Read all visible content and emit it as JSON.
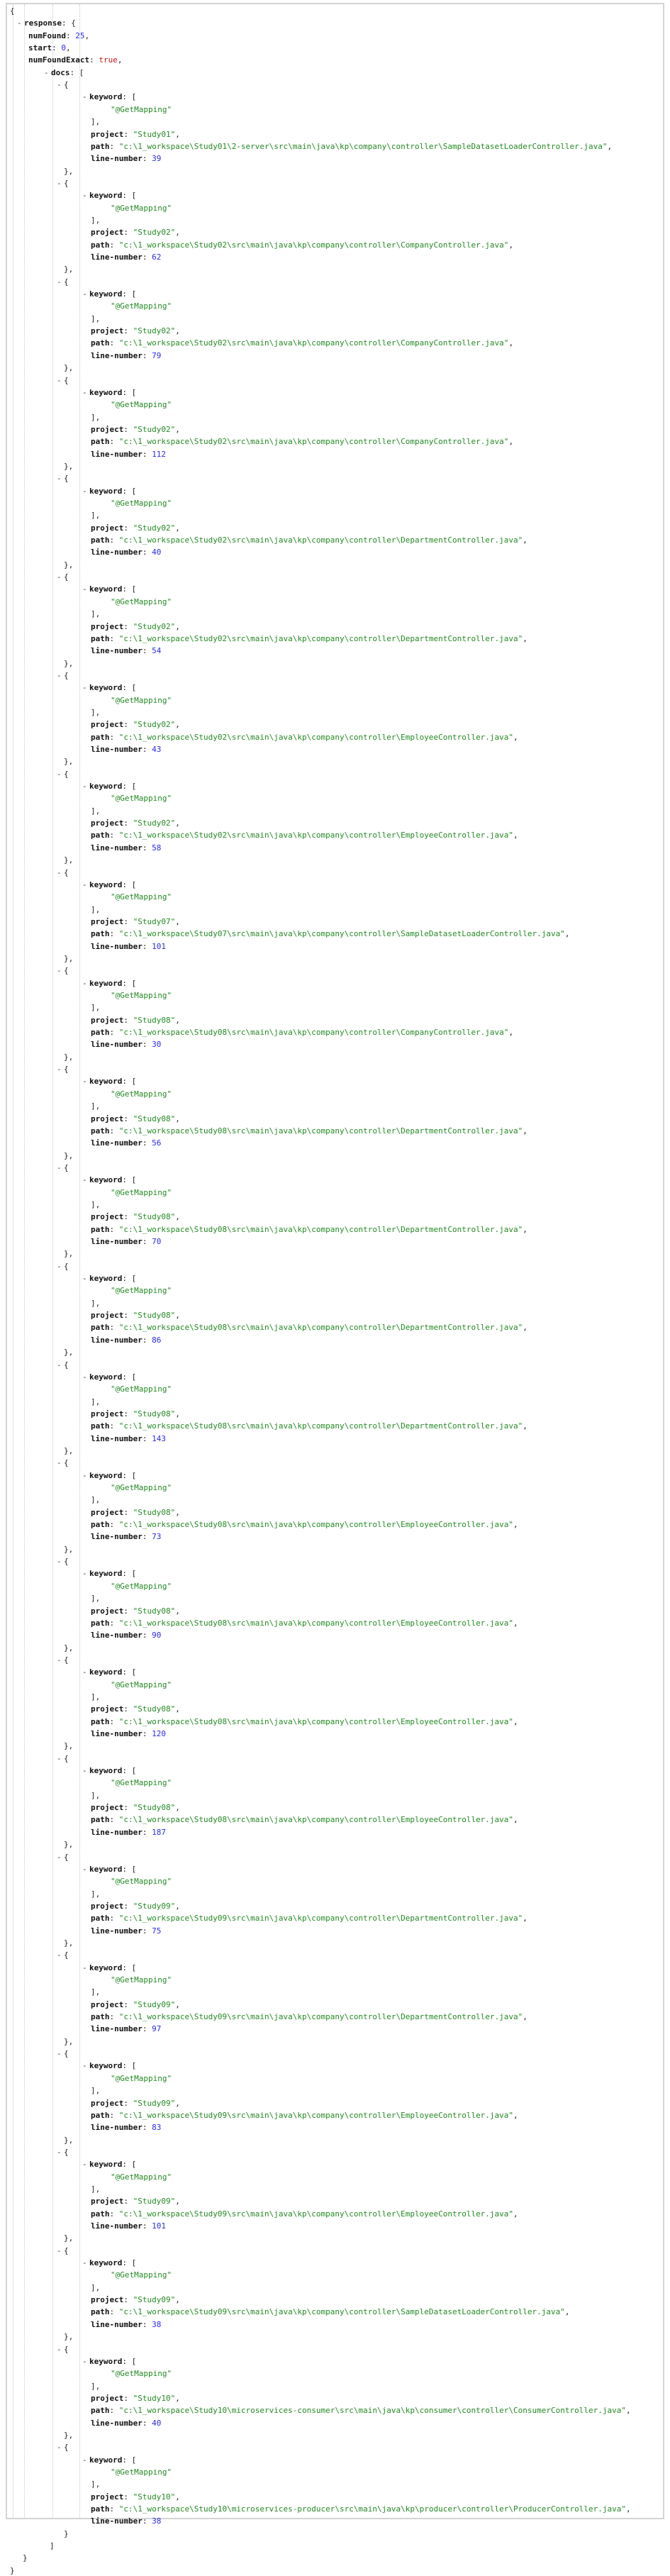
{
  "response": {
    "numFound": 25,
    "start": 0,
    "numFoundExact": true,
    "docs": [
      {
        "keyword": [
          "@GetMapping"
        ],
        "project": "Study01",
        "path": "c:\\1_workspace\\Study01\\2-server\\src\\main\\java\\kp\\company\\controller\\SampleDatasetLoaderController.java",
        "line_number": 39
      },
      {
        "keyword": [
          "@GetMapping"
        ],
        "project": "Study02",
        "path": "c:\\1_workspace\\Study02\\src\\main\\java\\kp\\company\\controller\\CompanyController.java",
        "line_number": 62
      },
      {
        "keyword": [
          "@GetMapping"
        ],
        "project": "Study02",
        "path": "c:\\1_workspace\\Study02\\src\\main\\java\\kp\\company\\controller\\CompanyController.java",
        "line_number": 79
      },
      {
        "keyword": [
          "@GetMapping"
        ],
        "project": "Study02",
        "path": "c:\\1_workspace\\Study02\\src\\main\\java\\kp\\company\\controller\\CompanyController.java",
        "line_number": 112
      },
      {
        "keyword": [
          "@GetMapping"
        ],
        "project": "Study02",
        "path": "c:\\1_workspace\\Study02\\src\\main\\java\\kp\\company\\controller\\DepartmentController.java",
        "line_number": 40
      },
      {
        "keyword": [
          "@GetMapping"
        ],
        "project": "Study02",
        "path": "c:\\1_workspace\\Study02\\src\\main\\java\\kp\\company\\controller\\DepartmentController.java",
        "line_number": 54
      },
      {
        "keyword": [
          "@GetMapping"
        ],
        "project": "Study02",
        "path": "c:\\1_workspace\\Study02\\src\\main\\java\\kp\\company\\controller\\EmployeeController.java",
        "line_number": 43
      },
      {
        "keyword": [
          "@GetMapping"
        ],
        "project": "Study02",
        "path": "c:\\1_workspace\\Study02\\src\\main\\java\\kp\\company\\controller\\EmployeeController.java",
        "line_number": 58
      },
      {
        "keyword": [
          "@GetMapping"
        ],
        "project": "Study07",
        "path": "c:\\1_workspace\\Study07\\src\\main\\java\\kp\\company\\controller\\SampleDatasetLoaderController.java",
        "line_number": 101
      },
      {
        "keyword": [
          "@GetMapping"
        ],
        "project": "Study08",
        "path": "c:\\1_workspace\\Study08\\src\\main\\java\\kp\\company\\controller\\CompanyController.java",
        "line_number": 30
      },
      {
        "keyword": [
          "@GetMapping"
        ],
        "project": "Study08",
        "path": "c:\\1_workspace\\Study08\\src\\main\\java\\kp\\company\\controller\\DepartmentController.java",
        "line_number": 56
      },
      {
        "keyword": [
          "@GetMapping"
        ],
        "project": "Study08",
        "path": "c:\\1_workspace\\Study08\\src\\main\\java\\kp\\company\\controller\\DepartmentController.java",
        "line_number": 70
      },
      {
        "keyword": [
          "@GetMapping"
        ],
        "project": "Study08",
        "path": "c:\\1_workspace\\Study08\\src\\main\\java\\kp\\company\\controller\\DepartmentController.java",
        "line_number": 86
      },
      {
        "keyword": [
          "@GetMapping"
        ],
        "project": "Study08",
        "path": "c:\\1_workspace\\Study08\\src\\main\\java\\kp\\company\\controller\\DepartmentController.java",
        "line_number": 143
      },
      {
        "keyword": [
          "@GetMapping"
        ],
        "project": "Study08",
        "path": "c:\\1_workspace\\Study08\\src\\main\\java\\kp\\company\\controller\\EmployeeController.java",
        "line_number": 73
      },
      {
        "keyword": [
          "@GetMapping"
        ],
        "project": "Study08",
        "path": "c:\\1_workspace\\Study08\\src\\main\\java\\kp\\company\\controller\\EmployeeController.java",
        "line_number": 90
      },
      {
        "keyword": [
          "@GetMapping"
        ],
        "project": "Study08",
        "path": "c:\\1_workspace\\Study08\\src\\main\\java\\kp\\company\\controller\\EmployeeController.java",
        "line_number": 120
      },
      {
        "keyword": [
          "@GetMapping"
        ],
        "project": "Study08",
        "path": "c:\\1_workspace\\Study08\\src\\main\\java\\kp\\company\\controller\\EmployeeController.java",
        "line_number": 187
      },
      {
        "keyword": [
          "@GetMapping"
        ],
        "project": "Study09",
        "path": "c:\\1_workspace\\Study09\\src\\main\\java\\kp\\company\\controller\\DepartmentController.java",
        "line_number": 75
      },
      {
        "keyword": [
          "@GetMapping"
        ],
        "project": "Study09",
        "path": "c:\\1_workspace\\Study09\\src\\main\\java\\kp\\company\\controller\\DepartmentController.java",
        "line_number": 97
      },
      {
        "keyword": [
          "@GetMapping"
        ],
        "project": "Study09",
        "path": "c:\\1_workspace\\Study09\\src\\main\\java\\kp\\company\\controller\\EmployeeController.java",
        "line_number": 83
      },
      {
        "keyword": [
          "@GetMapping"
        ],
        "project": "Study09",
        "path": "c:\\1_workspace\\Study09\\src\\main\\java\\kp\\company\\controller\\EmployeeController.java",
        "line_number": 101
      },
      {
        "keyword": [
          "@GetMapping"
        ],
        "project": "Study09",
        "path": "c:\\1_workspace\\Study09\\src\\main\\java\\kp\\company\\controller\\SampleDatasetLoaderController.java",
        "line_number": 38
      },
      {
        "keyword": [
          "@GetMapping"
        ],
        "project": "Study10",
        "path": "c:\\1_workspace\\Study10\\microservices-consumer\\src\\main\\java\\kp\\consumer\\controller\\ConsumerController.java",
        "line_number": 40
      },
      {
        "keyword": [
          "@GetMapping"
        ],
        "project": "Study10",
        "path": "c:\\1_workspace\\Study10\\microservices-producer\\src\\main\\java\\kp\\producer\\controller\\ProducerController.java",
        "line_number": 38
      }
    ]
  },
  "labels": {
    "response": "response",
    "numFound": "numFound",
    "start": "start",
    "numFoundExact": "numFoundExact",
    "docs": "docs",
    "keyword": "keyword",
    "project": "project",
    "path": "path",
    "line_number": "line-number"
  },
  "toggle_glyph": "-",
  "colors": {
    "key": "#111111",
    "string": "#238a23",
    "number": "#2a2ae6",
    "boolean": "#c41a16",
    "guide": "#c8c8c8",
    "border": "#d4d4d4"
  }
}
